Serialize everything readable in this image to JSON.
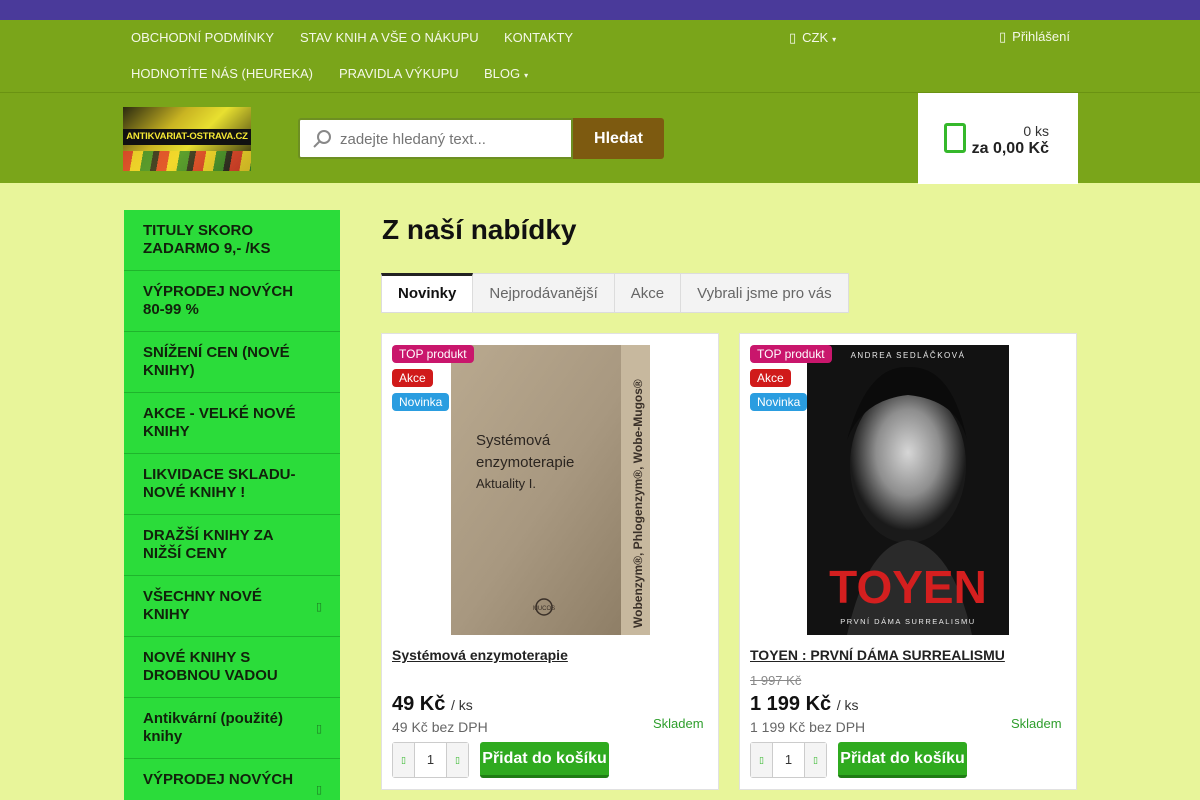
{
  "topnav": {
    "links": [
      "OBCHODNÍ PODMÍNKY",
      "STAV KNIH A VŠE O NÁKUPU",
      "KONTAKTY",
      "HODNOTÍTE NÁS (HEUREKA)",
      "PRAVIDLA VÝKUPU",
      "BLOG"
    ],
    "currency": "CZK",
    "login": "Přihlášení"
  },
  "logo": {
    "text": "ANTIKVARIAT-OSTRAVA.CZ"
  },
  "search": {
    "placeholder": "zadejte hledaný text...",
    "button_label": "Hledat"
  },
  "cart": {
    "quantity": "0 ks",
    "total": "za 0,00 Kč"
  },
  "sidebar": {
    "items": [
      "TITULY SKORO ZADARMO 9,- /KS",
      "VÝPRODEJ NOVÝCH 80-99 %",
      "SNÍŽENÍ CEN (NOVÉ KNIHY)",
      "AKCE - VELKÉ NOVÉ KNIHY",
      "LIKVIDACE SKLADU- NOVÉ KNIHY !",
      "DRAŽŠÍ KNIHY ZA NIŽŠÍ CENY",
      "VŠECHNY NOVÉ KNIHY",
      "NOVÉ KNIHY S DROBNOU VADOU",
      "Antikvární (použité) knihy",
      "VÝPRODEJ NOVÝCH"
    ]
  },
  "main": {
    "title": "Z naší nabídky",
    "tabs": [
      "Novinky",
      "Nejprodávanější",
      "Akce",
      "Vybrali jsme pro vás"
    ],
    "active_tab": "Novinky"
  },
  "products": [
    {
      "name": "Systémová enzymoterapie",
      "old_price": "",
      "price": "49 Kč",
      "unit": "/ ks",
      "price_net": "49 Kč bez DPH",
      "stock": "Skladem",
      "qty": "1",
      "add_label": "Přidat do košíku",
      "flags": [
        "TOP produkt",
        "Akce",
        "Novinka"
      ],
      "cover": {
        "title_line1": "Systémová",
        "title_line2": "enzymoterapie",
        "title_line3": "Aktuality I.",
        "spine": "Wobenzym®, Phlogenzym®, Wobe-Mugos®",
        "publisher": "MUCOS"
      }
    },
    {
      "name": "TOYEN : PRVNÍ DÁMA SURREALISMU",
      "old_price": "1 997 Kč",
      "price": "1 199 Kč",
      "unit": "/ ks",
      "price_net": "1 199 Kč bez DPH",
      "stock": "Skladem",
      "qty": "1",
      "add_label": "Přidat do košíku",
      "flags": [
        "TOP produkt",
        "Akce",
        "Novinka"
      ],
      "cover": {
        "author": "ANDREA SEDLÁČKOVÁ",
        "title": "TOYEN",
        "subtitle": "PRVNÍ DÁMA SURREALISMU"
      }
    }
  ],
  "colors": {
    "top_strip": "#4a3a9a",
    "nav_green": "#7aa51a",
    "page_bg": "#e8f59a",
    "sidebar_green": "#2bdc3a",
    "add_button": "#2faa1f",
    "search_button": "#7d5a10",
    "toyen_red": "#d41f1f"
  }
}
